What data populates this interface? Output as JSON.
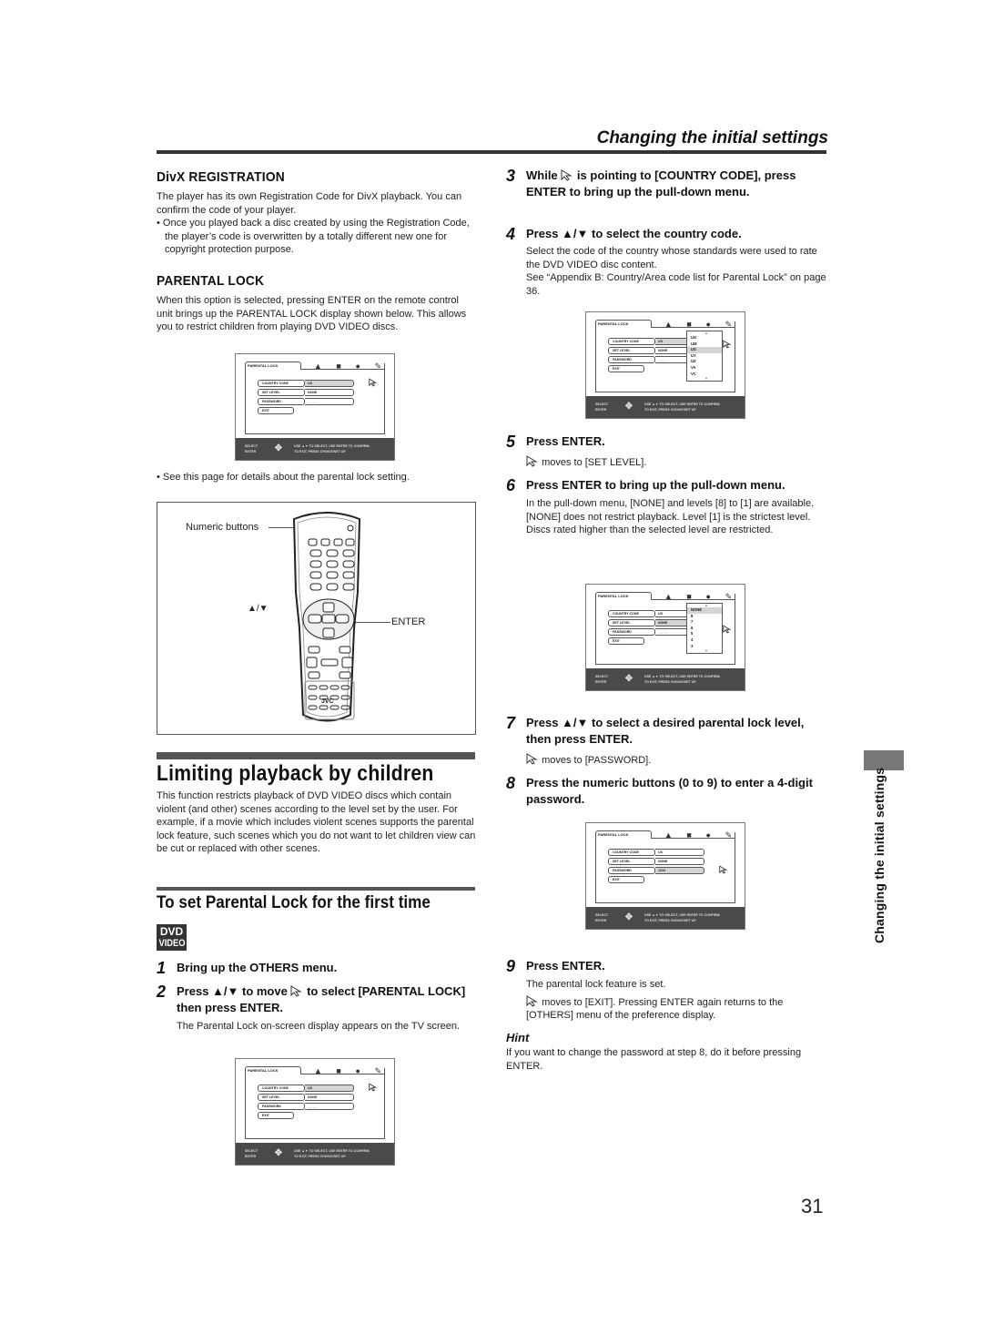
{
  "header": {
    "section_title": "Changing the initial settings",
    "page_number": "31"
  },
  "divx": {
    "heading": "DivX REGISTRATION",
    "para": "The player has its own Registration Code for DivX playback. You can confirm the code of your player.",
    "bullet": "Once you played back a disc created by using the Registration Code, the player’s code is overwritten by a totally different new one for copyright protection purpose."
  },
  "parental": {
    "heading": "PARENTAL LOCK",
    "para": "When this option is selected, pressing ENTER on the remote control unit brings up the PARENTAL LOCK display shown below. This allows you to restrict children from playing DVD VIDEO discs.",
    "bullet": "See this page for details about the parental lock setting."
  },
  "remote": {
    "label_numeric": "Numeric buttons",
    "label_arrows": "▲/▼",
    "label_enter": "ENTER",
    "brand": "JVC"
  },
  "limiting": {
    "heading": "Limiting playback by children",
    "para": "This function restricts playback of DVD VIDEO discs which contain violent (and other) scenes according to the level set by the user. For example, if a movie which includes violent scenes supports the parental lock feature, such scenes which you do not want to let children view can be cut or replaced with other scenes."
  },
  "first_time": {
    "heading": "To set Parental Lock for the first time",
    "badge": {
      "line1": "DVD",
      "line2": "VIDEO"
    }
  },
  "steps": [
    {
      "num": "1",
      "text": "Bring up the OTHERS menu.",
      "desc": ""
    },
    {
      "num": "2",
      "text_a": "Press ▲/▼ to move",
      "text_b": "to select [PARENTAL LOCK] then press ENTER.",
      "desc": "The Parental Lock on-screen display appears on the TV screen."
    },
    {
      "num": "3",
      "text_a": "While",
      "text_b": "is pointing to [COUNTRY CODE], press ENTER to bring up the pull-down menu.",
      "desc": ""
    },
    {
      "num": "4",
      "text": "Press ▲/▼ to select the country code.",
      "desc": "Select the code of the country whose standards were used to rate the DVD VIDEO disc content.",
      "desc2": "See “Appendix B: Country/Area code list for Parental Lock” on page 36."
    },
    {
      "num": "5",
      "text": "Press ENTER.",
      "desc": "moves to [SET LEVEL]."
    },
    {
      "num": "6",
      "text": "Press ENTER to bring up the pull-down menu.",
      "desc": "In the pull-down menu, [NONE] and levels [8] to [1] are available.",
      "desc2": "[NONE] does not restrict playback. Level [1] is the strictest level. Discs rated higher than the selected level are restricted."
    },
    {
      "num": "7",
      "text": "Press ▲/▼ to select a desired parental lock level, then press ENTER.",
      "desc": "moves to [PASSWORD]."
    },
    {
      "num": "8",
      "text": "Press the numeric buttons (0 to 9) to enter a 4-digit password.",
      "desc": ""
    },
    {
      "num": "9",
      "text": "Press ENTER.",
      "desc": "The parental lock feature is set.",
      "desc2": "moves to [EXIT]. Pressing ENTER again returns to the [OTHERS] menu of the preference display."
    }
  ],
  "hint": {
    "title": "Hint",
    "text": "If you want to change the password at step 8, do it before pressing ENTER."
  },
  "osd": {
    "tab": "PARENTAL LOCK",
    "rows": [
      "COUNTRY CODE",
      "SET LEVEL",
      "PASSWORD",
      "EXIT"
    ],
    "country_value": "US",
    "level_value": "NONE",
    "password_placeholder": "_ _ _ _",
    "password_value": "1234",
    "footer_select": "SELECT",
    "footer_enter": "ENTER",
    "footer_msg1": "USE ▲▼ TO SELECT, USE ENTER TO CONFIRM.",
    "footer_msg2": "TO EXIT, PRESS CHOICE/SET UP.",
    "country_options": [
      "UG",
      "UM",
      "US",
      "UY",
      "UZ",
      "VA",
      "VC"
    ],
    "level_options": [
      "NONE",
      "8",
      "7",
      "6",
      "5",
      "4",
      "3"
    ]
  },
  "side": {
    "tab_text": "Changing the initial settings"
  }
}
